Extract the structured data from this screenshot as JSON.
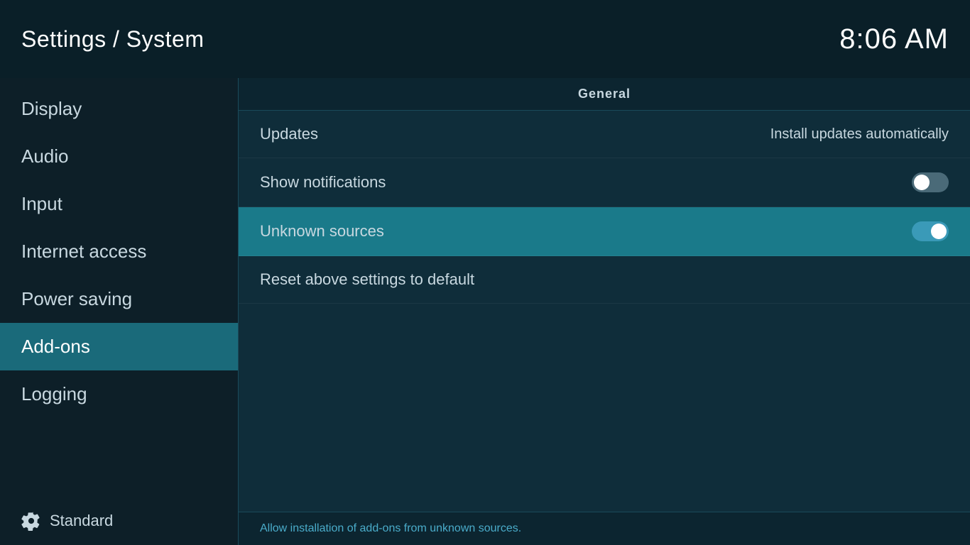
{
  "header": {
    "title": "Settings / System",
    "time": "8:06 AM"
  },
  "sidebar": {
    "items": [
      {
        "id": "display",
        "label": "Display",
        "active": false
      },
      {
        "id": "audio",
        "label": "Audio",
        "active": false
      },
      {
        "id": "input",
        "label": "Input",
        "active": false
      },
      {
        "id": "internet-access",
        "label": "Internet access",
        "active": false
      },
      {
        "id": "power-saving",
        "label": "Power saving",
        "active": false
      },
      {
        "id": "add-ons",
        "label": "Add-ons",
        "active": true
      },
      {
        "id": "logging",
        "label": "Logging",
        "active": false
      }
    ],
    "bottom_label": "Standard"
  },
  "content": {
    "section_title": "General",
    "rows": [
      {
        "id": "updates",
        "label": "Updates",
        "value": "Install updates automatically",
        "toggle": null
      },
      {
        "id": "show-notifications",
        "label": "Show notifications",
        "value": null,
        "toggle": "off"
      },
      {
        "id": "unknown-sources",
        "label": "Unknown sources",
        "value": null,
        "toggle": "on",
        "highlighted": true
      },
      {
        "id": "reset-settings",
        "label": "Reset above settings to default",
        "value": null,
        "toggle": null
      }
    ],
    "footer_hint": "Allow installation of add-ons from unknown sources."
  }
}
